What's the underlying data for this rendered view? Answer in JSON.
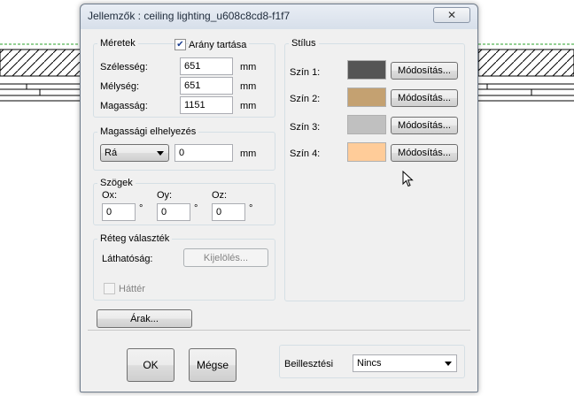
{
  "window": {
    "title": "Jellemzők : ceiling lighting_u608c8cd8-f1f7",
    "close_label": "✕"
  },
  "dimensions": {
    "group_label": "Méretek",
    "keep_ratio": {
      "label": "Arány tartása",
      "checked": true
    },
    "width": {
      "label": "Szélesség:",
      "value": "651",
      "unit": "mm"
    },
    "depth": {
      "label": "Mélység:",
      "value": "651",
      "unit": "mm"
    },
    "height": {
      "label": "Magasság:",
      "value": "1151",
      "unit": "mm"
    }
  },
  "elevation": {
    "group_label": "Magassági elhelyezés",
    "mode": "Rá",
    "value": "0",
    "unit": "mm"
  },
  "angles": {
    "group_label": "Szögek",
    "ox": {
      "label": "Ox:",
      "value": "0",
      "unit": "°"
    },
    "oy": {
      "label": "Oy:",
      "value": "0",
      "unit": "°"
    },
    "oz": {
      "label": "Oz:",
      "value": "0",
      "unit": "°"
    }
  },
  "layers": {
    "group_label": "Réteg választék",
    "visibility_label": "Láthatóság:",
    "select_button": "Kijelölés..."
  },
  "background": {
    "label": "Háttér",
    "checked": false
  },
  "prices_button": "Árak...",
  "style": {
    "group_label": "Stílus",
    "colors": [
      {
        "label": "Szín 1:",
        "color": "#555555",
        "button": "Módosítás..."
      },
      {
        "label": "Szín 2:",
        "color": "#c4a171",
        "button": "Módosítás..."
      },
      {
        "label": "Szín 3:",
        "color": "#c0c0c0",
        "button": "Módosítás..."
      },
      {
        "label": "Szín 4:",
        "color": "#ffcc99",
        "button": "Módosítás..."
      }
    ]
  },
  "footer": {
    "ok": "OK",
    "cancel": "Mégse",
    "insert_label": "Beillesztési",
    "insert_value": "Nincs"
  }
}
